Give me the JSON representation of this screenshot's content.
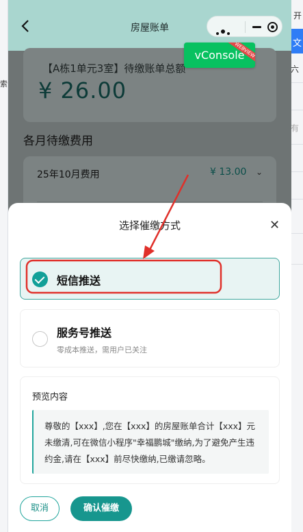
{
  "background_app": {
    "top_text": "开",
    "blue_text": "文",
    "side_text_1": "六",
    "side_text_2": "有",
    "left_text": "索"
  },
  "nav": {
    "title": "房屋账单"
  },
  "summary": {
    "label": "【A栋1单元3室】待缴账单总额",
    "amount": "¥ 26.00"
  },
  "vconsole": {
    "label": "vConsole",
    "ribbon": "WEBVIEW"
  },
  "section": {
    "title": "各月待缴费用"
  },
  "months": [
    {
      "label": "25年10月费用",
      "amount": "¥ 13.00"
    }
  ],
  "sheet": {
    "title": "选择催缴方式",
    "close_icon": "close-icon"
  },
  "options": [
    {
      "label": "短信推送",
      "sub": "",
      "selected": true
    },
    {
      "label": "服务号推送",
      "sub": "零成本推送，需用户已关注",
      "selected": false
    }
  ],
  "preview": {
    "title": "预览内容",
    "text": "尊敬的【xxx】,您在【xxx】的房屋账单合计【xxx】元未缴清,可在微信小程序\"幸福鹏城\"缴纳,为了避免产生违约金,请在【xxx】前尽快缴纳,已缴请忽略。"
  },
  "buttons": {
    "cancel": "取消",
    "confirm": "确认催缴"
  },
  "colors": {
    "accent": "#17968e",
    "header": "#a9d6cf",
    "annotation": "#e0302a"
  }
}
